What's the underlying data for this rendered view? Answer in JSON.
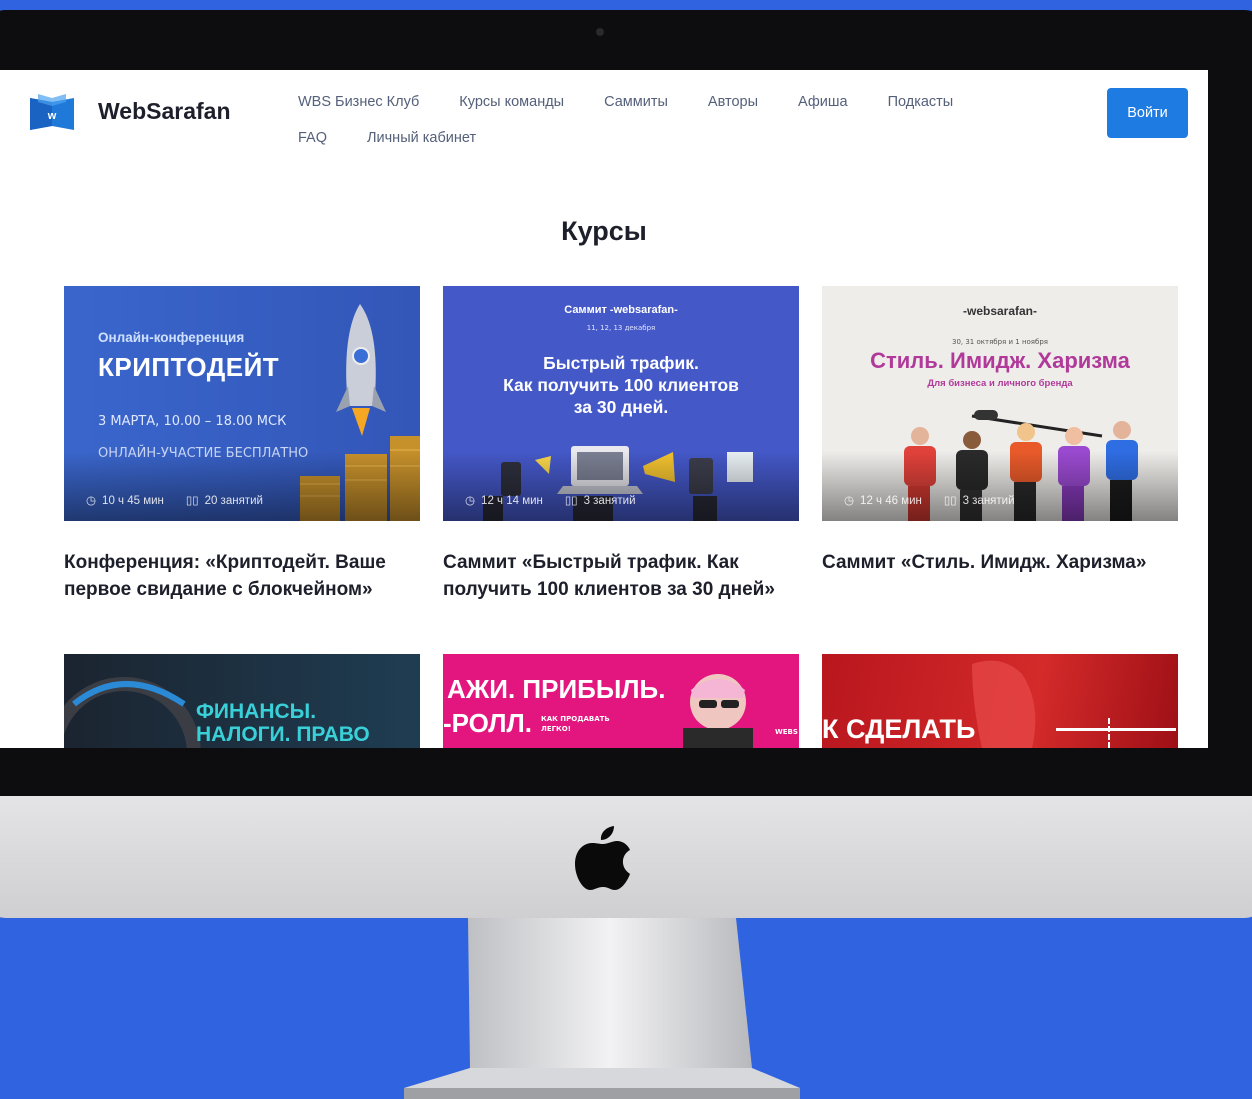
{
  "header": {
    "logo_letter": "w",
    "brand": "WebSarafan",
    "nav_row1": [
      "WBS Бизнес Клуб",
      "Курсы команды",
      "Саммиты",
      "Авторы",
      "Афиша",
      "Подкасты"
    ],
    "nav_row2": [
      "FAQ",
      "Личный кабинет"
    ],
    "login_label": "Войти"
  },
  "section_title": "Курсы",
  "cards": [
    {
      "subtitle": "Онлайн-конференция",
      "headline": "КРИПТОДЕЙТ",
      "line1": "3 МАРТА, 10.00 – 18.00 МСК",
      "line2": "ОНЛАЙН-УЧАСТИЕ БЕСПЛАТНО",
      "duration": "10 ч 45 мин",
      "lessons": "20 занятий",
      "title": "Конференция: «Криптодейт. Ваше первое свидание с блокчейном»",
      "bg": "#3563c9"
    },
    {
      "brand": "Саммит -websarafan-",
      "dates": "11, 12, 13 декабря",
      "headline1": "Быстрый трафик.",
      "headline2": "Как получить 100 клиентов",
      "headline3": "за 30 дней.",
      "duration": "12 ч 14 мин",
      "lessons": "3 занятий",
      "title": "Саммит «Быстрый трафик. Как получить 100 клиентов за 30 дней»",
      "bg": "#4458c8"
    },
    {
      "brand": "-websarafan-",
      "dates": "30, 31 октября и 1 ноября",
      "headline": "Стиль. Имидж. Харизма",
      "sub": "Для бизнеса и личного бренда",
      "duration": "12 ч 46 мин",
      "lessons": "3 занятий",
      "title": "Саммит «Стиль. Имидж. Харизма»",
      "bg": "#efedea",
      "accent": "#b0399a"
    }
  ],
  "bottom_cards": [
    {
      "text1": "ФИНАНСЫ.",
      "text2": "НАЛОГИ. ПРАВО"
    },
    {
      "text1": "АЖИ. ПРИБЫЛЬ.",
      "text2": "-РОЛЛ.",
      "small1": "КАК ПРОДАВАТЬ",
      "small2": "ЛЕГКО!",
      "tag": "WEBS"
    },
    {
      "text1": "К СДЕЛАТЬ"
    }
  ],
  "colors": {
    "background": "#2f63e0",
    "primary": "#1e7be2",
    "text": "#1d1f2b",
    "nav": "#55607a"
  }
}
